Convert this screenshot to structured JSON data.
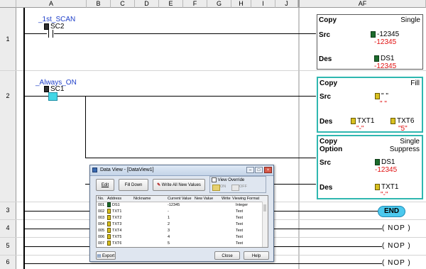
{
  "columns": [
    "A",
    "B",
    "C",
    "D",
    "E",
    "F",
    "G",
    "H",
    "I",
    "J",
    "AF"
  ],
  "rows": [
    "1",
    "2",
    "3",
    "4",
    "5",
    "6"
  ],
  "rungs": {
    "r1": {
      "nickname": "_1st_SCAN",
      "contact": "SC2"
    },
    "r2": {
      "nickname": "_Always_ON",
      "contact": "SC1"
    }
  },
  "boxes": {
    "copy_single": {
      "title": "Copy",
      "mode": "Single",
      "src_label": "Src",
      "src_value": "-12345",
      "src_display": "-12345",
      "des_label": "Des",
      "des_value": "DS1",
      "des_display": "-12345"
    },
    "copy_fill": {
      "title": "Copy",
      "mode": "Fill",
      "src_label": "Src",
      "src_value": "\" \"",
      "src_display": "\" \"",
      "des_label": "Des",
      "des_from": "TXT1",
      "des_from_display": "\"-\"",
      "des_to": "TXT6",
      "des_to_display": "\"5\""
    },
    "copy_option": {
      "title": "Copy",
      "title2": "Option",
      "mode": "Single",
      "mode2": "Suppress",
      "src_label": "Src",
      "src_value": "DS1",
      "src_display": "-12345",
      "des_label": "Des",
      "des_value": "TXT1",
      "des_display": "\"-\""
    }
  },
  "end_label": "END",
  "nop_label": "( NOP )",
  "dialog": {
    "title": "Data View - [DataView1]",
    "edit": "Edit",
    "fill_down": "Fill Down",
    "write_all": "Write All New Values",
    "view_override": "View Override",
    "ovr_on": "ON",
    "ovr_off": "OFF",
    "headers": [
      "No.",
      "Address",
      "Nickname",
      "Current Value",
      "New Value",
      "Write",
      "Viewing Format"
    ],
    "rows": [
      {
        "no": "001",
        "addr": "DS1",
        "nick": "",
        "cur": "-12345",
        "new": "",
        "fmt": "Integer"
      },
      {
        "no": "002",
        "addr": "TXT1",
        "nick": "",
        "cur": "-",
        "new": "",
        "fmt": "Text"
      },
      {
        "no": "003",
        "addr": "TXT2",
        "nick": "",
        "cur": "1",
        "new": "",
        "fmt": "Text"
      },
      {
        "no": "004",
        "addr": "TXT3",
        "nick": "",
        "cur": "2",
        "new": "",
        "fmt": "Text"
      },
      {
        "no": "005",
        "addr": "TXT4",
        "nick": "",
        "cur": "3",
        "new": "",
        "fmt": "Text"
      },
      {
        "no": "006",
        "addr": "TXT5",
        "nick": "",
        "cur": "4",
        "new": "",
        "fmt": "Text"
      },
      {
        "no": "007",
        "addr": "TXT6",
        "nick": "",
        "cur": "5",
        "new": "",
        "fmt": "Text"
      }
    ],
    "export": "Export",
    "close": "Close",
    "help": "Help"
  }
}
